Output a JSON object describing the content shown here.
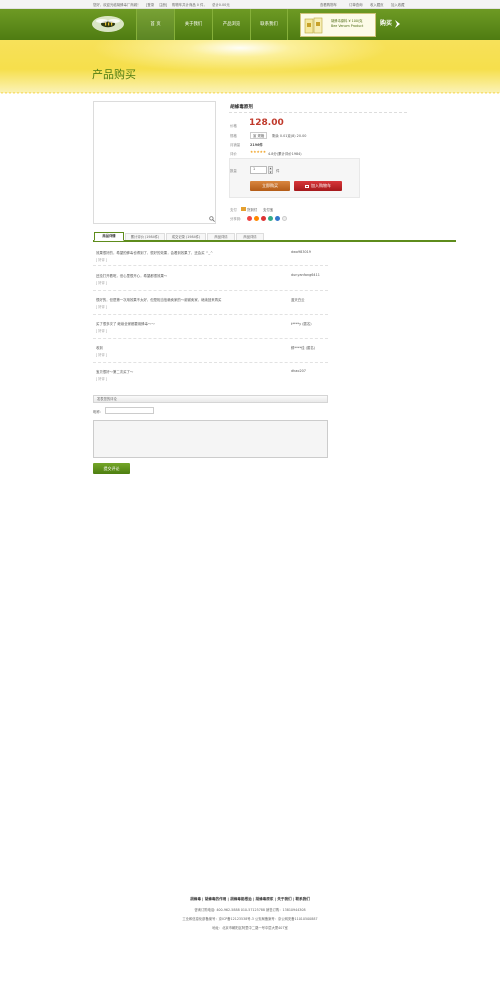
{
  "topbar": {
    "welcome": "您好，欢迎光临胡蜂毒厂商城！",
    "login": "[登录",
    "register": "注册]",
    "cart_info": "购物车共计商品 0 件，",
    "total": "总计0.00元",
    "links": [
      "查看购物车",
      "订单查询",
      "收入藏页",
      "加入收藏"
    ]
  },
  "nav": {
    "items": [
      "首 页",
      "关于我们",
      "产品浏览",
      "联系我们"
    ],
    "promo_line1": "胡蜂毒原料 ¥ 100/克",
    "promo_line2": "Bee Venom Product",
    "buy_label": "购买"
  },
  "banner": {
    "title": "产品购买"
  },
  "product": {
    "name": "胡蜂毒原剂",
    "price_label": "价格",
    "price": "128.00",
    "spec_label": "规格",
    "spec_value": "宣 规格",
    "stock_text": "剩余 0.01克(8)  20.00",
    "sales_label": "月销量",
    "sales_value": "2196件",
    "rating_label": "评价",
    "rating_stars": "★★★★★",
    "rating_text": "4.8分(累计评价1984)",
    "qty_label": "数量",
    "qty_value": "1",
    "qty_unit": "件",
    "buy_now": "立即购买",
    "add_cart": "加入购物车",
    "delivery_label": "支付",
    "delivery_value": "货到付",
    "guarantee": "支付宝",
    "share_label": "分享到:",
    "share_colors": [
      "#e44",
      "#f80",
      "#d33",
      "#3a8",
      "#37c"
    ]
  },
  "tabs": [
    "商品详情",
    "累计评价 (1984件)",
    "成交记录 (1984件)",
    "商品详情",
    "商品详情"
  ],
  "reviews": [
    {
      "text": "效果很好的，希望的蜂毒也得到了，很好的效果，会看到效果了，还会买 ^_^",
      "tag": "[ 好评 ]",
      "user": "dwo983019"
    },
    {
      "text": "还没打开看呢，但心里很开心，希望都很效果～",
      "tag": "[ 好评 ]",
      "user": "dunyanfang6411"
    },
    {
      "text": "很好的，但是第一次用效果不太好，但是相当信赖卖家的～谢谢卖家，继续回来再买",
      "tag": "[ 好评 ]",
      "user": "蓝天白云"
    },
    {
      "text": "买了很多次了 继续全家都要用蜂毒～～",
      "tag": "[ 好评 ]",
      "user": "t****y (匿名)"
    },
    {
      "text": "收到",
      "tag": "[ 好评 ]",
      "user": "鲜****佳 (匿名)"
    },
    {
      "text": "宝贝很好～第二次买了～",
      "tag": "[ 好评 ]",
      "user": "dhao207"
    }
  ],
  "comment": {
    "header": "发表您的评论",
    "name_label": "昵称：",
    "submit": "提交评论"
  },
  "footer": {
    "links": "胡蜂毒 | 胡蜂毒的作用 | 胡蜂毒能根治 | 胡蜂毒原浆 | 关于我们 | 联系我们",
    "line1": "咨询订购电话: 400-962-5888  010-57125788  销售订购：13810944308",
    "line2": "工业和信息化部备案号：京ICP备12123538号-3  公安局备案号：京公网安备11010500887",
    "line3": "地址：北京市朝阳区阿里中二路一号中层大厦407室"
  }
}
